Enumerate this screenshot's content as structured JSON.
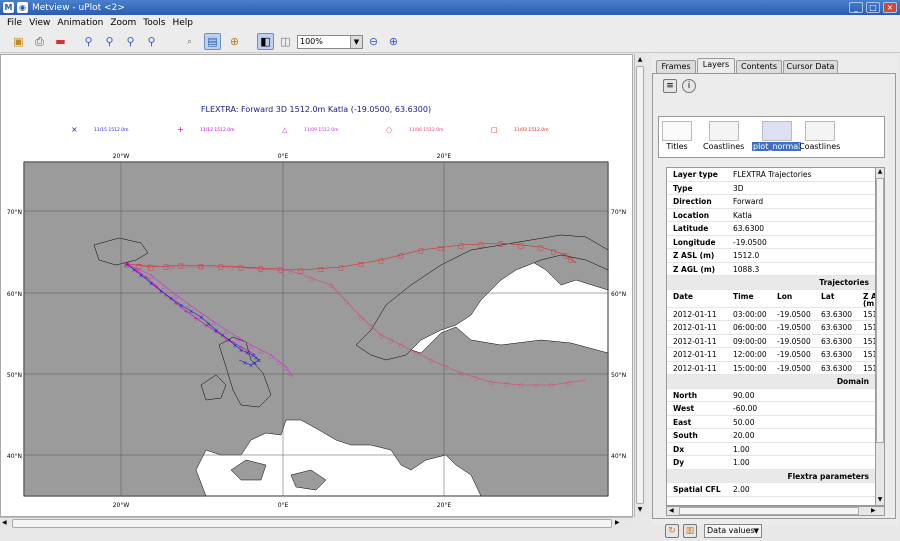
{
  "window": {
    "title": "Metview - uPlot <2>",
    "controls": [
      "_",
      "□",
      "×"
    ]
  },
  "menu": [
    "File",
    "View",
    "Animation",
    "Zoom",
    "Tools",
    "Help"
  ],
  "toolbar": {
    "zoom_value": "100%"
  },
  "plot": {
    "title": "FLEXTRA: Forward 3D 1512.0m Katla (-19.0500, 63.6300)",
    "legend": [
      {
        "symbol": "×",
        "label": "11/15 1512.0m",
        "color": "#2222cc"
      },
      {
        "symbol": "+",
        "label": "11/12 1512.0m",
        "color": "#cc00cc"
      },
      {
        "symbol": "△",
        "label": "11/09 1512.0m",
        "color": "#cc33cc"
      },
      {
        "symbol": "○",
        "label": "11/06 1512.0m",
        "color": "#e0407a"
      },
      {
        "symbol": "□",
        "label": "11/03 1512.0m",
        "color": "#dd2222"
      }
    ],
    "lon_labels": [
      "20°W",
      "0°E",
      "20°E"
    ],
    "lat_labels": [
      "70°N",
      "60°N",
      "50°N",
      "40°N"
    ]
  },
  "panel": {
    "tabs": [
      "Frames",
      "Layers",
      "Contents",
      "Cursor Data"
    ],
    "active_tab": "Layers",
    "layers": [
      {
        "name": "Titles",
        "selected": false
      },
      {
        "name": "Coastlines",
        "selected": false
      },
      {
        "name": "plot_normal",
        "selected": true
      },
      {
        "name": "Coastlines",
        "selected": false
      }
    ],
    "info": [
      {
        "key": "Layer type",
        "value": "FLEXTRA Trajectories"
      },
      {
        "key": "Type",
        "value": "3D"
      },
      {
        "key": "Direction",
        "value": "Forward"
      },
      {
        "key": "Location",
        "value": "Katla"
      },
      {
        "key": "Latitude",
        "value": "63.6300"
      },
      {
        "key": "Longitude",
        "value": "-19.0500"
      },
      {
        "key": "Z ASL (m)",
        "value": "1512.0"
      },
      {
        "key": "Z AGL (m)",
        "value": "1088.3"
      }
    ],
    "trajectories_header": "Trajectories",
    "traj_columns": [
      "Date",
      "Time",
      "Lon",
      "Lat",
      "Z AS"
    ],
    "traj_columns_sub": "(m)",
    "traj_rows": [
      [
        "2012-01-11",
        "03:00:00",
        "-19.0500",
        "63.6300",
        "151"
      ],
      [
        "2012-01-11",
        "06:00:00",
        "-19.0500",
        "63.6300",
        "151"
      ],
      [
        "2012-01-11",
        "09:00:00",
        "-19.0500",
        "63.6300",
        "151"
      ],
      [
        "2012-01-11",
        "12:00:00",
        "-19.0500",
        "63.6300",
        "151"
      ],
      [
        "2012-01-11",
        "15:00:00",
        "-19.0500",
        "63.6300",
        "151"
      ]
    ],
    "domain_header": "Domain",
    "domain": [
      {
        "key": "North",
        "value": "90.00"
      },
      {
        "key": "West",
        "value": "-60.00"
      },
      {
        "key": "East",
        "value": "50.00"
      },
      {
        "key": "South",
        "value": "20.00"
      },
      {
        "key": "Dx",
        "value": "1.00"
      },
      {
        "key": "Dy",
        "value": "1.00"
      }
    ],
    "flextra_header": "Flextra parameters",
    "flextra": [
      {
        "key": "Spatial CFL",
        "value": "2.00"
      }
    ],
    "data_values_label": "Data values"
  }
}
